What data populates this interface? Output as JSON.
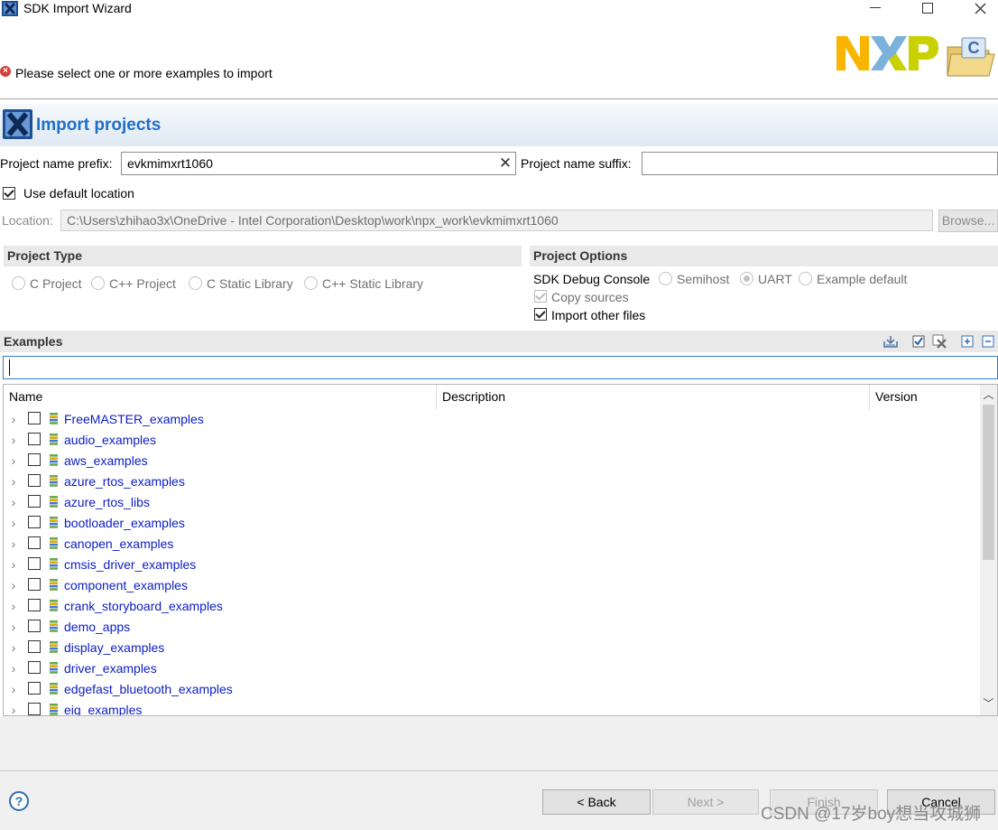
{
  "window": {
    "title": "SDK Import Wizard",
    "minimize_glyph": "—",
    "maximize_glyph": "☐",
    "close_glyph": "✕"
  },
  "header": {
    "message": "Please select one or more examples to import",
    "logo_text": "NXP"
  },
  "banner": {
    "title": "Import projects"
  },
  "names": {
    "prefix_label": "Project name prefix:",
    "prefix_value": "evkmimxrt1060",
    "suffix_label": "Project name suffix:",
    "suffix_value": ""
  },
  "location": {
    "use_default_label": "Use default location",
    "use_default_checked": true,
    "label": "Location:",
    "value": "C:\\Users\\zhihao3x\\OneDrive - Intel Corporation\\Desktop\\work\\npx_work\\evkmimxrt1060",
    "browse_label": "Browse..."
  },
  "project_type": {
    "header": "Project Type",
    "options": [
      "C Project",
      "C++ Project",
      "C Static Library",
      "C++ Static Library"
    ]
  },
  "project_options": {
    "header": "Project Options",
    "console_label": "SDK Debug Console",
    "console_options": [
      "Semihost",
      "UART",
      "Example default"
    ],
    "console_selected": "UART",
    "copy_sources_label": "Copy sources",
    "import_other_label": "Import other files"
  },
  "examples": {
    "header": "Examples",
    "columns": [
      "Name",
      "Description",
      "Version"
    ],
    "items": [
      "FreeMASTER_examples",
      "audio_examples",
      "aws_examples",
      "azure_rtos_examples",
      "azure_rtos_libs",
      "bootloader_examples",
      "canopen_examples",
      "cmsis_driver_examples",
      "component_examples",
      "crank_storyboard_examples",
      "demo_apps",
      "display_examples",
      "driver_examples",
      "edgefast_bluetooth_examples",
      "eiq_examples"
    ]
  },
  "footer": {
    "help_glyph": "?",
    "back_label": "< Back",
    "next_label": "Next >",
    "finish_label": "Finish",
    "cancel_label": "Cancel",
    "watermark": "CSDN @17岁boy想当攻城狮"
  },
  "colors": {
    "banner_title": "#1e6fc5",
    "link": "#0b1dc4",
    "error": "#d2413a",
    "nxp_yellow": "#f9b500",
    "nxp_blue": "#7bb1db",
    "nxp_green": "#c9d200"
  }
}
